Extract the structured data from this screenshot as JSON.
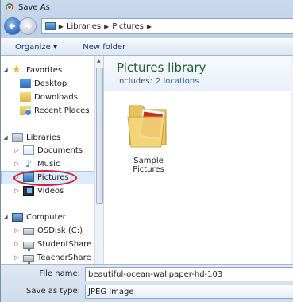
{
  "window": {
    "title": "Save As"
  },
  "address": {
    "crumbs": [
      "Libraries",
      "Pictures"
    ]
  },
  "toolbar": {
    "organize_label": "Organize",
    "new_folder_label": "New folder"
  },
  "nav": {
    "favorites_label": "Favorites",
    "favorites": [
      "Desktop",
      "Downloads",
      "Recent Places"
    ],
    "libraries_label": "Libraries",
    "libraries": [
      "Documents",
      "Music",
      "Pictures",
      "Videos"
    ],
    "computer_label": "Computer",
    "drives": [
      "OSDisk (C:)",
      "StudentShare (S:)",
      "TeacherShare (T:"
    ]
  },
  "content": {
    "title": "Pictures library",
    "includes_label": "Includes:",
    "includes_link": "2 locations",
    "items": [
      {
        "label": "Sample Pictures",
        "icon": "folder-with-photo-icon"
      }
    ]
  },
  "form": {
    "filename_label": "File name:",
    "filename_value": "beautiful-ocean-wallpaper-hd-103",
    "type_label": "Save as type:",
    "type_value": "JPEG Image"
  },
  "colors": {
    "annotation": "#d31c2f",
    "library_title": "#1e5a2e",
    "link": "#2a64b8"
  }
}
